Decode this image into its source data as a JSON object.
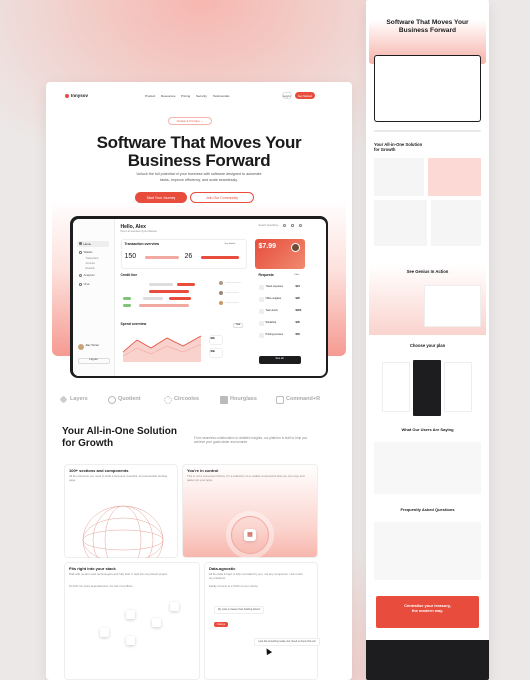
{
  "nav": {
    "brand": "Innysov",
    "links": [
      "Product",
      "Resources",
      "Pricing",
      "Security",
      "Testimonials"
    ],
    "login": "Log In",
    "cta": "Get Started"
  },
  "hero": {
    "badge": "Version 2.3 is here →",
    "title_1": "Software That Moves Your",
    "title_2": "Business Forward",
    "subtitle_1": "Unlock the full potential of your business with software designed to automate",
    "subtitle_2": "tasks, improve efficiency, and scale seamlessly.",
    "btn_primary": "Start Your Journey",
    "btn_secondary": "Join Our Community"
  },
  "dashboard": {
    "sidebar": [
      "Home",
      "Wallets",
      "Transactions",
      "Accounts",
      "Rewards",
      "Analytics",
      "Chat"
    ],
    "user": "Alex Turner",
    "logout": "Log out",
    "greeting": "Hello, Alex",
    "greeting_sub": "Here's an overview of your finances",
    "search": "Search something...",
    "tx_title": "Transaction overview",
    "tx_link": "See details",
    "stat1": "150",
    "stat2": "26",
    "promo_price": "$7.99",
    "credit_title": "Credit line",
    "requests_title": "Requests",
    "requests_filter": "Filter",
    "requests": [
      {
        "name": "Travel expenses",
        "amt": "$24"
      },
      {
        "name": "Office supplies",
        "amt": "$95"
      },
      {
        "name": "Team lunch",
        "amt": "$200"
      },
      {
        "name": "Workshop",
        "amt": "$35"
      },
      {
        "name": "Printing services",
        "amt": "$50"
      }
    ],
    "spend_title": "Spend overview",
    "spend_filter": "Year",
    "see_all": "See all",
    "spend_stats": [
      "$2k",
      "$3k"
    ]
  },
  "logos": [
    "Layers",
    "Quotient",
    "Circooles",
    "Hourglass",
    "Command+R"
  ],
  "features": {
    "title_1": "Your All-in-One Solution",
    "title_2": "for Growth",
    "desc": "From seamless collaboration to detailed insights, our platform is built to help you achieve your goals faster and smarter.",
    "cards": [
      {
        "title": "100+ sections and components",
        "desc": "All the elements you need to build a business, beautiful, and accessible landing page."
      },
      {
        "title": "You're in control",
        "desc": "This is not a component library. It's a collection of re-usable components that you can copy and paste into your apps."
      },
      {
        "title": "Fits right into your stack",
        "desc": "Built with modern web technologies and fully fluid. It right into any React project.",
        "desc2": "No fluff. No extra dependencies. No risk of conflicts."
      },
      {
        "title": "Data-agnostic",
        "desc": "All the data & logic is fully controlled by you, not any component. Use it with any backend.",
        "desc2": "Easily connect to a CMS of your choice."
      }
    ],
    "chat_1": "My code is cleaner than building before!",
    "chat_badge": "Code.js",
    "chat_2": "I just did something really cool. Need to check this out!"
  },
  "mini": {
    "title_1": "Software That Moves Your",
    "title_2": "Business Forward",
    "sec_title_1": "Your All-in-One Solution",
    "sec_title_2": "for Growth",
    "genius": "See Genius In Action",
    "plan": "Choose your plan",
    "users": "What Our Users Are Saying",
    "faq": "Frequently Asked Questions",
    "cta_1": "Centralise your treasury,",
    "cta_2": "the modern way."
  },
  "colors": {
    "accent": "#e74c3c",
    "dark": "#1d1d1f",
    "pink": "#f59b92"
  }
}
